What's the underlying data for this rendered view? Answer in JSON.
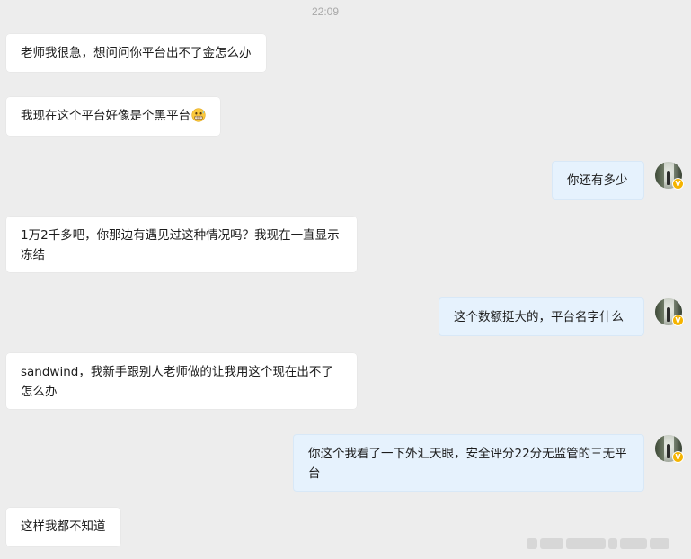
{
  "timestamp": "22:09",
  "messages": [
    {
      "side": "left",
      "text": "老师我很急，想问问你平台出不了金怎么办"
    },
    {
      "side": "left",
      "text": "我现在这个平台好像是个黑平台",
      "emoji": "grimacing-face-emoji"
    },
    {
      "side": "right",
      "text": "你还有多少"
    },
    {
      "side": "left",
      "text": "1万2千多吧，你那边有遇见过这种情况吗？我现在一直显示冻结"
    },
    {
      "side": "right",
      "text": "这个数额挺大的，平台名字什么"
    },
    {
      "side": "left",
      "text": "sandwind，我新手跟别人老师做的让我用这个现在出不了怎么办"
    },
    {
      "side": "right",
      "text": "你这个我看了一下外汇天眼，安全评分22分无监管的三无平台"
    },
    {
      "side": "left",
      "text": "这样我都不知道"
    }
  ],
  "avatar": {
    "badge": "V",
    "badge_color": "#f5b400"
  },
  "colors": {
    "background": "#ededed",
    "left_bubble": "#ffffff",
    "right_bubble": "#e6f2fd",
    "text": "#1c1c1c",
    "timestamp": "#a9a9a9"
  }
}
